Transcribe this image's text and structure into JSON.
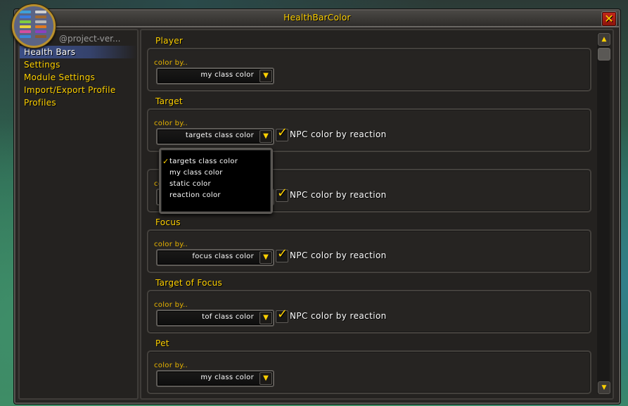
{
  "window": {
    "title": "HealthBarColor",
    "close_icon": "close-icon"
  },
  "addon_icon": {
    "name": "health-bars-icon",
    "bar_colors_left": [
      "#3fa0d8",
      "#3a7ae0",
      "#7ecb40",
      "#e8d23a",
      "#d44ea0",
      "#3a86d8"
    ],
    "bar_colors_right": [
      "#d0d0d0",
      "#a06a30",
      "#b8b8b8",
      "#e07a20",
      "#8a40c0",
      "#8a5a30"
    ]
  },
  "sidebar": {
    "profile_name": "@project-ver...",
    "items": [
      {
        "label": "Health Bars",
        "active": true
      },
      {
        "label": "Settings",
        "active": false
      },
      {
        "label": "Module Settings",
        "active": false
      },
      {
        "label": "Import/Export Profile",
        "active": false
      },
      {
        "label": "Profiles",
        "active": false
      }
    ]
  },
  "groups": [
    {
      "title": "Player",
      "color_label": "color by..",
      "dropdown_value": "my class color",
      "has_npc_checkbox": false
    },
    {
      "title": "Target",
      "color_label": "color by..",
      "dropdown_value": "targets class color",
      "has_npc_checkbox": true,
      "npc_label": "NPC color by reaction",
      "npc_checked": true
    },
    {
      "title": "",
      "color_label": "color by..",
      "dropdown_value": "",
      "has_npc_checkbox": true,
      "npc_label": "NPC color by reaction",
      "npc_checked": true
    },
    {
      "title": "Focus",
      "color_label": "color by..",
      "dropdown_value": "focus class color",
      "has_npc_checkbox": true,
      "npc_label": "NPC color by reaction",
      "npc_checked": true
    },
    {
      "title": "Target of Focus",
      "color_label": "color by..",
      "dropdown_value": "tof class color",
      "has_npc_checkbox": true,
      "npc_label": "NPC color by reaction",
      "npc_checked": true
    },
    {
      "title": "Pet",
      "color_label": "color by..",
      "dropdown_value": "my class color",
      "has_npc_checkbox": false
    }
  ],
  "open_dropdown": {
    "options": [
      {
        "label": "targets class color",
        "selected": true
      },
      {
        "label": "my class color",
        "selected": false
      },
      {
        "label": "static color",
        "selected": false
      },
      {
        "label": "reaction color",
        "selected": false
      }
    ]
  },
  "scrollbar": {
    "position_fraction": 0.0
  },
  "colors": {
    "accent_gold": "#ffd100",
    "active_nav": "#3c508c",
    "close_red": "#c4281c"
  }
}
